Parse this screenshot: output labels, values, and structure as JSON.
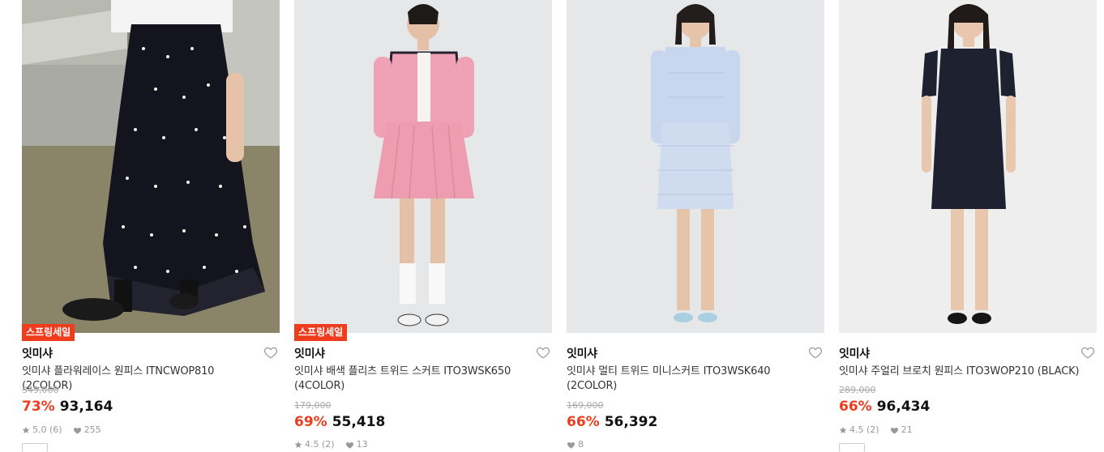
{
  "products": [
    {
      "badge": "스프링세일",
      "brand": "잇미샤",
      "name": "잇미샤 플라워레이스 원피스 ITNCWOP810 (2COLOR)",
      "original_price": "349,000",
      "discount": "73%",
      "price": "93,164",
      "rating": "5.0 (6)",
      "likes": "255"
    },
    {
      "badge": "스프링세일",
      "brand": "잇미샤",
      "name": "잇미샤 배색 플리츠 트위드 스커트 ITO3WSK650 (4COLOR)",
      "original_price": "179,000",
      "discount": "69%",
      "price": "55,418",
      "rating": "4.5 (2)",
      "likes": "13"
    },
    {
      "badge": "",
      "brand": "잇미샤",
      "name": "잇미샤 멀티 트위드 미니스커트 ITO3WSK640 (2COLOR)",
      "original_price": "169,000",
      "discount": "66%",
      "price": "56,392",
      "rating": "",
      "likes": "8"
    },
    {
      "badge": "",
      "brand": "잇미샤",
      "name": "잇미샤 주얼리 브로치 원피스 ITO3WOP210 (BLACK)",
      "original_price": "289,000",
      "discount": "66%",
      "price": "96,434",
      "rating": "4.5 (2)",
      "likes": "21"
    }
  ],
  "colors": {
    "accent": "#ef3c1f",
    "muted": "#999999"
  },
  "icons": [
    "heart-icon",
    "star-icon",
    "heart-small-icon"
  ]
}
